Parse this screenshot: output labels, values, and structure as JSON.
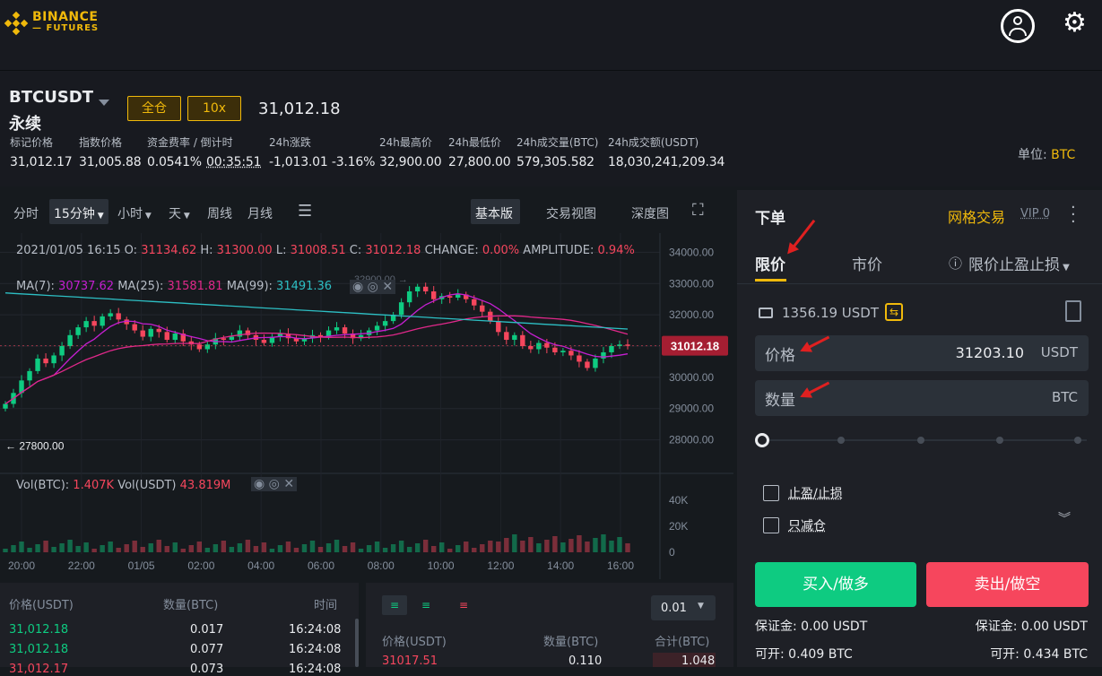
{
  "brand": {
    "line1": "BINANCE",
    "line2": "FUTURES"
  },
  "header": {
    "symbol": "BTCUSDT",
    "contract": "永续",
    "margin_mode": "全仓",
    "leverage": "10x",
    "last_price": "31,012.18",
    "unit_label": "单位:",
    "unit_value": "BTC",
    "stats": [
      {
        "label": "标记价格",
        "value": "31,012.17"
      },
      {
        "label": "指数价格",
        "value": "31,005.88"
      },
      {
        "label": "资金费率 / 倒计时",
        "value": "0.0541%",
        "value2": "00:35:51"
      },
      {
        "label": "24h涨跌",
        "value": "-1,013.01 -3.16%"
      },
      {
        "label": "24h最高价",
        "value": "32,900.00"
      },
      {
        "label": "24h最低价",
        "value": "27,800.00"
      },
      {
        "label": "24h成交量(BTC)",
        "value": "579,305.582"
      },
      {
        "label": "24h成交额(USDT)",
        "value": "18,030,241,209.34"
      }
    ]
  },
  "chart_toolbar": {
    "intervals": [
      "分时",
      "15分钟",
      "小时",
      "天",
      "周线",
      "月线"
    ],
    "views": [
      "基本版",
      "交易视图",
      "深度图"
    ]
  },
  "ohlc": {
    "date": "2021/01/05 16:15",
    "o_label": "O:",
    "o": "31134.62",
    "h_label": "H:",
    "h": "31300.00",
    "l_label": "L:",
    "l": "31008.51",
    "c_label": "C:",
    "c": "31012.18",
    "change_label": "CHANGE:",
    "change": "0.00%",
    "amp_label": "AMPLITUDE:",
    "amp": "0.94%"
  },
  "ma": {
    "ma7_label": "MA(7):",
    "ma7": "30737.62",
    "ma25_label": "MA(25):",
    "ma25": "31581.81",
    "ma99_label": "MA(99):",
    "ma99": "31491.36"
  },
  "vol": {
    "btc_label": "Vol(BTC):",
    "btc": "1.407K",
    "usdt_label": "Vol(USDT)",
    "usdt": "43.819M"
  },
  "chart_data": {
    "type": "candlestick",
    "y_ticks": [
      "34000.00",
      "33000.00",
      "32000.00",
      "31000.00",
      "30000.00",
      "29000.00",
      "28000.00"
    ],
    "ylim": [
      27500,
      34500
    ],
    "x_ticks": [
      "20:00",
      "22:00",
      "01/05",
      "02:00",
      "04:00",
      "06:00",
      "08:00",
      "10:00",
      "12:00",
      "14:00",
      "16:00"
    ],
    "vol_ticks": [
      "40K",
      "20K",
      "0"
    ],
    "current_price": "31012.18",
    "low_marker": "27800.00",
    "high_marker": "32900.00",
    "close_series": [
      29150,
      29500,
      29900,
      30200,
      30600,
      30450,
      30700,
      31000,
      31350,
      31600,
      31800,
      31650,
      31950,
      32050,
      31850,
      31700,
      31500,
      31300,
      31550,
      31450,
      31200,
      31400,
      31150,
      31050,
      30900,
      31050,
      31250,
      31200,
      31300,
      31500,
      31350,
      31200,
      31100,
      31300,
      31400,
      31250,
      31150,
      31250,
      31350,
      31300,
      31500,
      31600,
      31400,
      31250,
      31350,
      31500,
      31650,
      31800,
      32000,
      32400,
      32750,
      32900,
      32750,
      32500,
      32600,
      32550,
      32650,
      32500,
      32300,
      32100,
      31800,
      31450,
      31200,
      31350,
      31000,
      30900,
      31100,
      30950,
      30800,
      30850,
      30700,
      30500,
      30300,
      30600,
      30800,
      31000,
      31050,
      31012
    ]
  },
  "order": {
    "title": "下单",
    "grid": "网格交易",
    "vip": "VIP 0",
    "tabs": [
      "限价",
      "市价",
      "限价止盈止损"
    ],
    "balance": "1356.19 USDT",
    "price_label": "价格",
    "price_value": "31203.10",
    "price_unit": "USDT",
    "qty_label": "数量",
    "qty_unit": "BTC",
    "tp_sl": "止盈/止损",
    "reduce_only": "只减仓",
    "buy": "买入/做多",
    "sell": "卖出/做空",
    "buy_margin": "保证金: 0.00 USDT",
    "sell_margin": "保证金: 0.00 USDT",
    "buy_open": "可开: 0.409 BTC",
    "sell_open": "可开: 0.434 BTC"
  },
  "trades": {
    "headers": [
      "价格(USDT)",
      "数量(BTC)",
      "时间"
    ],
    "rows": [
      [
        "31,012.18",
        "0.017",
        "16:24:08"
      ],
      [
        "31,012.18",
        "0.077",
        "16:24:08"
      ],
      [
        "31,012.17",
        "0.073",
        "16:24:08"
      ]
    ]
  },
  "book": {
    "precision": "0.01",
    "headers": [
      "价格(USDT)",
      "数量(BTC)",
      "合计(BTC)"
    ],
    "rows": [
      [
        "31017.51",
        "0.110",
        "1.048"
      ]
    ]
  },
  "colors": {
    "up": "#0ecb81",
    "down": "#f6465d",
    "accent": "#f0b90b",
    "annotation": "#e02020"
  }
}
